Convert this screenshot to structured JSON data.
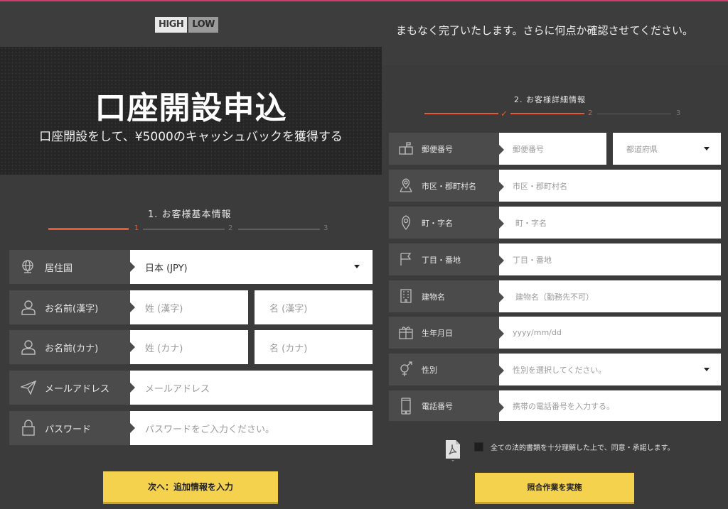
{
  "left": {
    "logo": {
      "high": "HIGH",
      "low": "LOW"
    },
    "hero": {
      "title": "口座開設申込",
      "subtitle": "口座開設をして、¥5000のキャッシュバックを獲得する"
    },
    "step": {
      "title": "1. お客様基本情報",
      "numbers": [
        "1",
        "2",
        "3"
      ]
    },
    "form": {
      "country": {
        "label": "居住国",
        "value": "日本 (JPY)"
      },
      "name_kanji": {
        "label": "お名前(漢字)",
        "last_placeholder": "姓 (漢字)",
        "first_placeholder": "名 (漢字)"
      },
      "name_kana": {
        "label": "お名前(カナ)",
        "last_placeholder": "姓 (カナ)",
        "first_placeholder": "名 (カナ)"
      },
      "email": {
        "label": "メールアドレス",
        "placeholder": "メールアドレス"
      },
      "password": {
        "label": "パスワード",
        "placeholder": "パスワードをご入力ください。"
      }
    },
    "next_button": "次へ：追加情報を入力"
  },
  "right": {
    "header_text": "まもなく完了いたします。さらに何点か確認させてください。",
    "step": {
      "title": "2. お客様詳細情報",
      "numbers": [
        "2",
        "3"
      ],
      "check": "✓"
    },
    "form": {
      "postal": {
        "label": "郵便番号",
        "placeholder": "郵便番号",
        "prefecture_placeholder": "都道府県"
      },
      "city": {
        "label": "市区・郡町村名",
        "placeholder": "市区・郡町村名"
      },
      "town": {
        "label": "町・字名",
        "placeholder": "町・字名"
      },
      "street": {
        "label": "丁目・番地",
        "placeholder": "丁目・番地"
      },
      "building": {
        "label": "建物名",
        "placeholder": "建物名（勤務先不可）"
      },
      "birthday": {
        "label": "生年月日",
        "placeholder": "yyyy/mm/dd"
      },
      "gender": {
        "label": "性別",
        "placeholder": "性別を選択してください。"
      },
      "phone": {
        "label": "電話番号",
        "placeholder": "携帯の電話番号を入力する。"
      }
    },
    "agree_text": "全ての法的書類を十分理解した上で、同意・承諾します。",
    "submit_button": "照合作業を実施"
  },
  "colors": {
    "accent": "#e55a35",
    "button": "#f5d24d",
    "label_bg": "#4b4b4b",
    "page_bg": "#3b3b3b",
    "top_line": "#cc3d6a"
  }
}
